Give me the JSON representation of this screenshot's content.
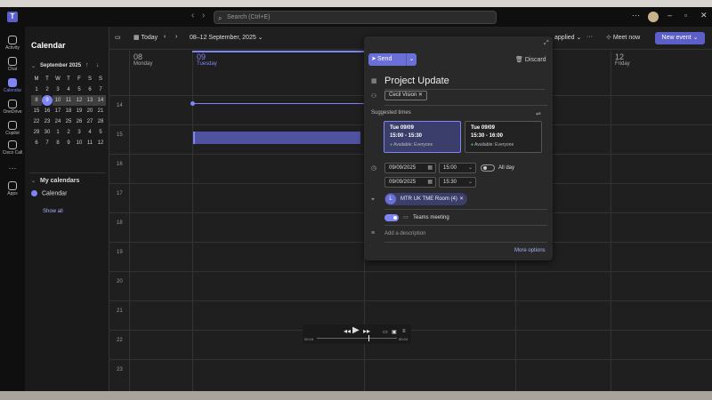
{
  "titlebar": {
    "search_placeholder": "Search (Ctrl+E)",
    "back": "‹",
    "forward": "›"
  },
  "rail": [
    {
      "label": "Activity"
    },
    {
      "label": "Chat"
    },
    {
      "label": "Calendar"
    },
    {
      "label": "OneDrive"
    },
    {
      "label": "Copilot"
    },
    {
      "label": "Cisco Call"
    },
    {
      "label": "Apps"
    }
  ],
  "left_panel": {
    "title": "Calendar",
    "month": "September 2025",
    "weekdays": [
      "M",
      "T",
      "W",
      "T",
      "F",
      "S",
      "S"
    ],
    "weeks": [
      [
        "1",
        "2",
        "3",
        "4",
        "5",
        "6",
        "7"
      ],
      [
        "8",
        "9",
        "10",
        "11",
        "12",
        "13",
        "14"
      ],
      [
        "15",
        "16",
        "17",
        "18",
        "19",
        "20",
        "21"
      ],
      [
        "22",
        "23",
        "24",
        "25",
        "26",
        "27",
        "28"
      ],
      [
        "29",
        "30",
        "1",
        "2",
        "3",
        "4",
        "5"
      ],
      [
        "6",
        "7",
        "8",
        "9",
        "10",
        "11",
        "12"
      ]
    ],
    "my_calendars": "My calendars",
    "calendar_item": "Calendar",
    "show_all": "Show all"
  },
  "toolbar": {
    "today": "Today",
    "range": "08–12 September, 2025",
    "applied": "applied",
    "meet_now": "Meet now",
    "new_event": "New event",
    "more": "···"
  },
  "days": [
    {
      "num": "08",
      "name": "Monday"
    },
    {
      "num": "09",
      "name": "Tuesday"
    },
    {
      "num": "12",
      "name": "Friday"
    }
  ],
  "hours": [
    "14",
    "15",
    "16",
    "17",
    "18",
    "19",
    "20",
    "21",
    "22",
    "23"
  ],
  "media": {
    "time_start": "00:16",
    "time_end": "00:24"
  },
  "popup": {
    "send": "Send",
    "discard": "Discard",
    "title": "Project Update",
    "attendee": "Cecil Vision",
    "suggested_times": "Suggested times",
    "suggestions": [
      {
        "date": "Tue 09/09",
        "time": "15:00 - 15:30",
        "availability": "Available: Everyone"
      },
      {
        "date": "Tue 09/09",
        "time": "15:30 - 16:00",
        "availability": "Available: Everyone"
      }
    ],
    "start_date": "09/09/2025",
    "start_time": "15:00",
    "end_date": "09/09/2025",
    "end_time": "15:30",
    "all_day": "All day",
    "room": "MTR UK TME Room (4)",
    "teams_meeting": "Teams meeting",
    "description_placeholder": "Add a description",
    "more_options": "More options"
  },
  "colors": {
    "accent": "#7f85f5",
    "brand": "#5b5fc7",
    "available": "#55b559"
  }
}
